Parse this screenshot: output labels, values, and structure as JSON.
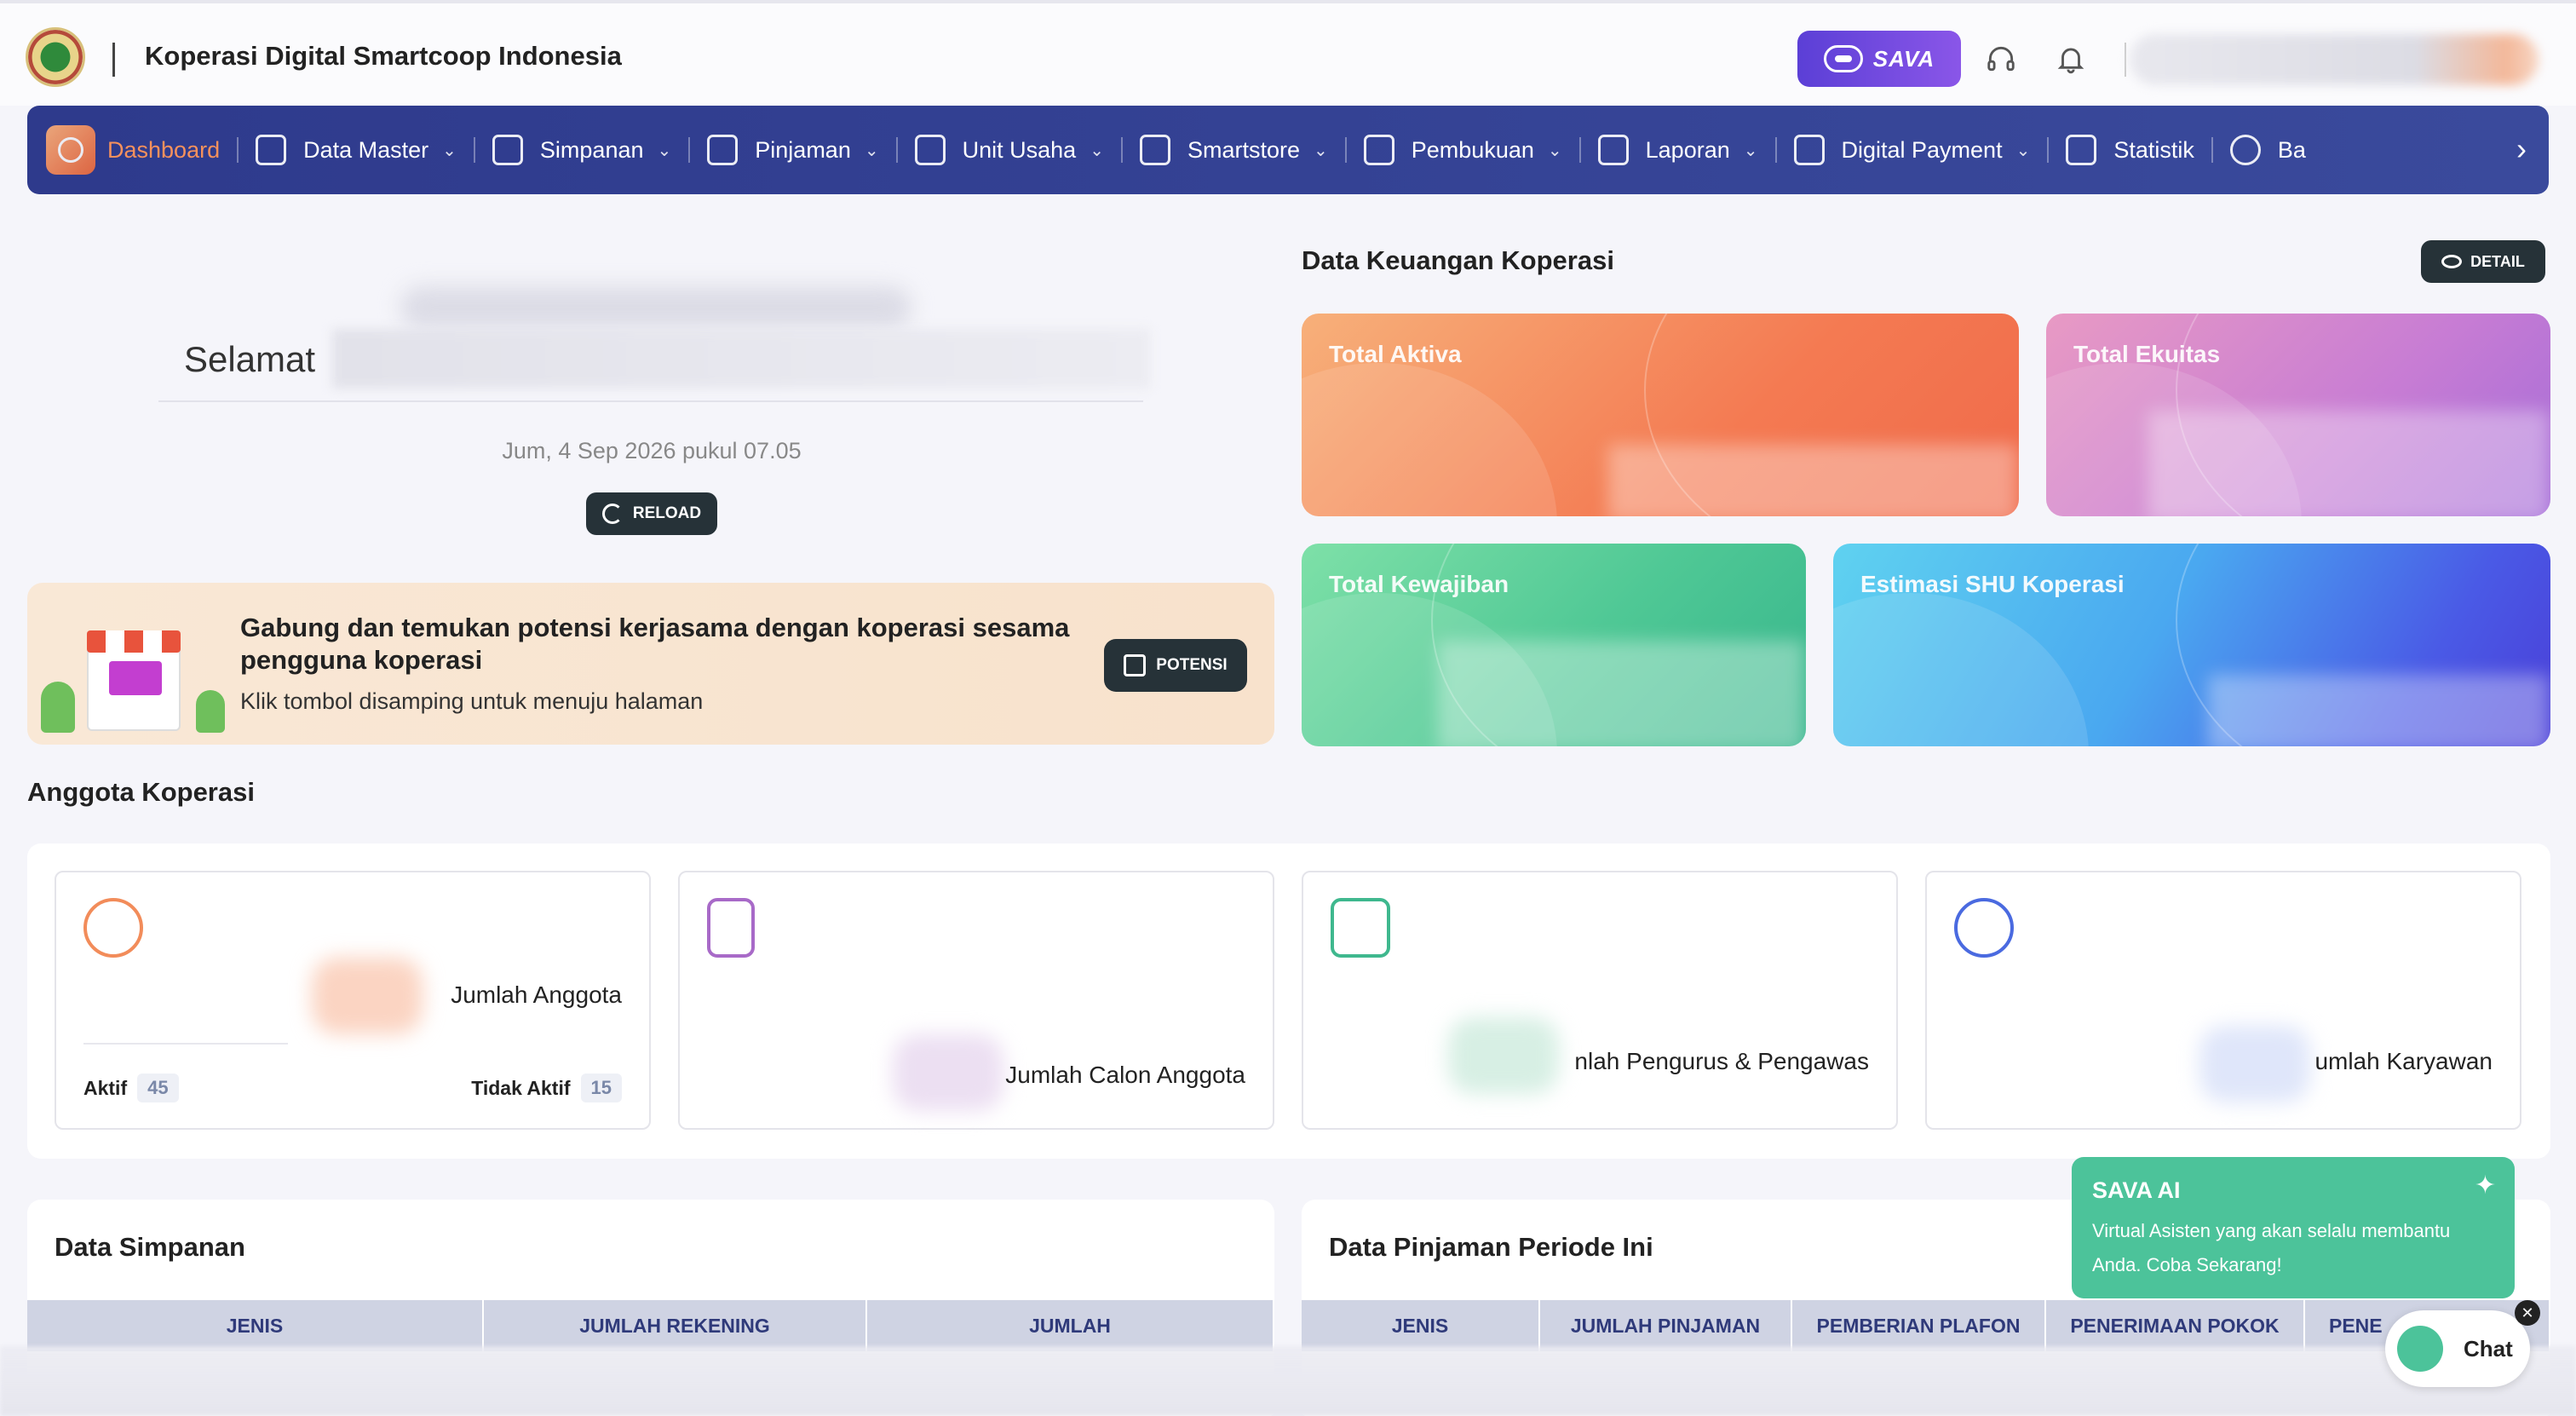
{
  "header": {
    "org_name": "Koperasi Digital Smartcoop Indonesia",
    "sava_label": "SAVA",
    "icons": [
      "headset-icon",
      "bell-icon"
    ]
  },
  "nav": {
    "items": [
      {
        "label": "Dashboard",
        "active": true,
        "dropdown": false
      },
      {
        "label": "Data Master",
        "dropdown": true
      },
      {
        "label": "Simpanan",
        "dropdown": true
      },
      {
        "label": "Pinjaman",
        "dropdown": true
      },
      {
        "label": "Unit Usaha",
        "dropdown": true
      },
      {
        "label": "Smartstore",
        "dropdown": true
      },
      {
        "label": "Pembukuan",
        "dropdown": true
      },
      {
        "label": "Laporan",
        "dropdown": true
      },
      {
        "label": "Digital Payment",
        "dropdown": true
      },
      {
        "label": "Statistik",
        "dropdown": false
      },
      {
        "label": "Ba",
        "dropdown": false
      }
    ]
  },
  "welcome": {
    "greeting": "Selamat",
    "date": "Jum, 4 Sep 2026 pukul 07.05",
    "reload_label": "RELOAD"
  },
  "potensi": {
    "title": "Gabung dan temukan potensi kerjasama dengan koperasi sesama pengguna koperasi",
    "subtitle": "Klik tombol disamping untuk menuju halaman",
    "button_label": "POTENSI"
  },
  "keuangan": {
    "title": "Data Keuangan Koperasi",
    "detail_label": "DETAIL",
    "cards": {
      "aktiva": "Total Aktiva",
      "ekuitas": "Total Ekuitas",
      "kewajiban": "Total Kewajiban",
      "shu": "Estimasi SHU Koperasi"
    }
  },
  "anggota": {
    "title": "Anggota Koperasi",
    "jumlah_anggota": "Jumlah Anggota",
    "aktif_label": "Aktif",
    "aktif_count": "45",
    "tidak_aktif_label": "Tidak Aktif",
    "tidak_aktif_count": "15",
    "calon_anggota": "Jumlah Calon Anggota",
    "pengurus": "nlah Pengurus & Pengawas",
    "karyawan": "umlah Karyawan"
  },
  "simpanan": {
    "title": "Data Simpanan",
    "columns": [
      "JENIS",
      "JUMLAH REKENING",
      "JUMLAH"
    ]
  },
  "pinjaman": {
    "title": "Data Pinjaman Periode Ini",
    "columns": [
      "JENIS",
      "JUMLAH PINJAMAN",
      "PEMBERIAN PLAFON",
      "PENERIMAAN POKOK",
      "PENE"
    ]
  },
  "sava_ai": {
    "title": "SAVA AI",
    "description": "Virtual Asisten yang akan selalu membantu Anda. Coba Sekarang!",
    "chat_label": "Chat"
  },
  "colors": {
    "nav_bg": "#2e3a8c",
    "accent_orange": "#f7915c",
    "sava_green": "#4cc39a",
    "dark_button": "#263238"
  }
}
